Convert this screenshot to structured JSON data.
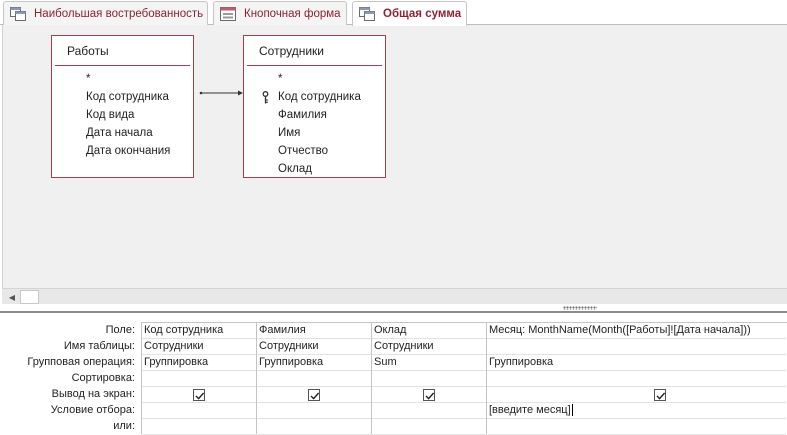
{
  "tabs": [
    {
      "label": "Наибольшая востребованность",
      "icon": "query-icon",
      "active": false
    },
    {
      "label": "Кнопочная форма",
      "icon": "form-icon",
      "active": false
    },
    {
      "label": "Общая сумма",
      "icon": "query-icon",
      "active": true
    }
  ],
  "tables": [
    {
      "title": "Работы",
      "fields": [
        "*",
        "Код сотрудника",
        "Код вида",
        "Дата начала",
        "Дата окончания"
      ]
    },
    {
      "title": "Сотрудники",
      "fields": [
        "*",
        "Код сотрудника",
        "Фамилия",
        "Имя",
        "Отчество",
        "Оклад"
      ],
      "key_field": "Код сотрудника"
    }
  ],
  "grid": {
    "row_labels": [
      "Поле:",
      "Имя таблицы:",
      "Групповая операция:",
      "Сортировка:",
      "Вывод на экран:",
      "Условие отбора:",
      "или:"
    ],
    "columns": [
      {
        "field": "Код сотрудника",
        "table": "Сотрудники",
        "total": "Группировка",
        "sort": "",
        "show": true,
        "criteria": "",
        "or": ""
      },
      {
        "field": "Фамилия",
        "table": "Сотрудники",
        "total": "Группировка",
        "sort": "",
        "show": true,
        "criteria": "",
        "or": ""
      },
      {
        "field": "Оклад",
        "table": "Сотрудники",
        "total": "Sum",
        "sort": "",
        "show": true,
        "criteria": "",
        "or": ""
      },
      {
        "field": "Месяц: MonthName(Month([Работы]![Дата начала]))",
        "table": "",
        "total": "Группировка",
        "sort": "",
        "show": true,
        "criteria": "[введите месяц]",
        "or": ""
      }
    ]
  },
  "colors": {
    "accent": "#8a2435",
    "table_border": "#a04050"
  }
}
